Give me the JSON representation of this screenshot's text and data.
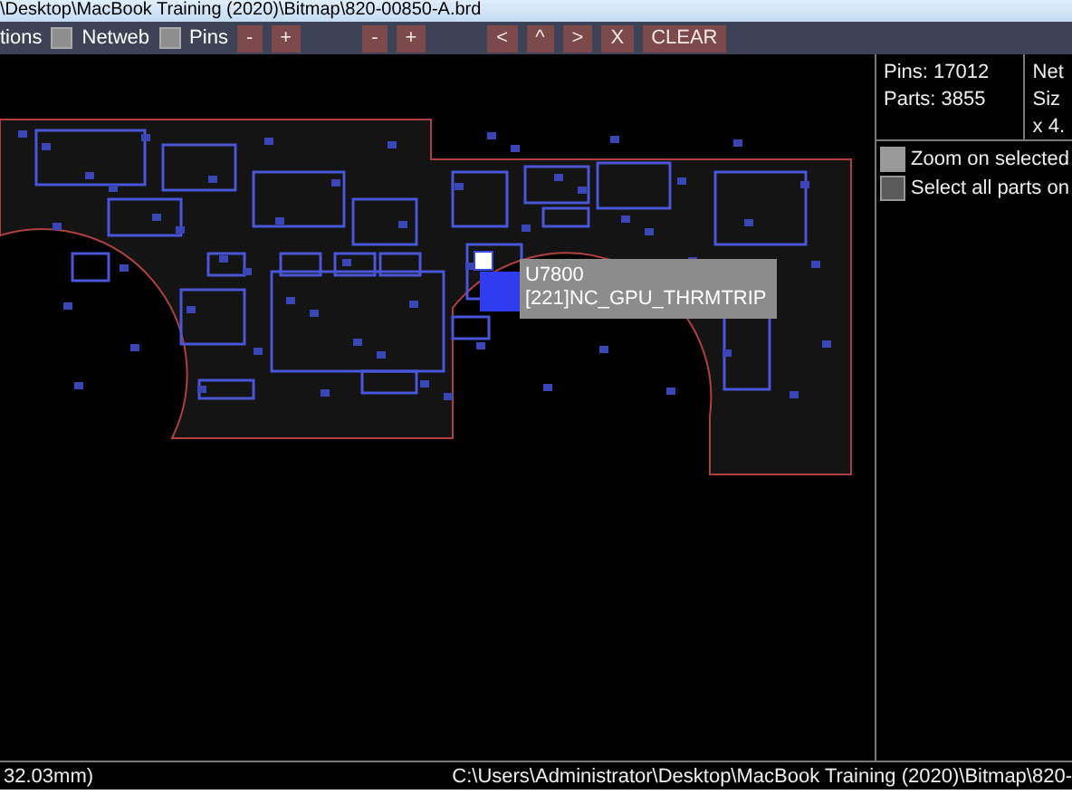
{
  "window": {
    "title": "\\Desktop\\MacBook Training (2020)\\Bitmap\\820-00850-A.brd"
  },
  "toolbar": {
    "items": [
      {
        "kind": "label",
        "label": "tions"
      },
      {
        "kind": "checkbox",
        "label": "Netweb",
        "checked": false
      },
      {
        "kind": "checkbox",
        "label": "Pins",
        "checked": false
      },
      {
        "kind": "button",
        "label": "-"
      },
      {
        "kind": "button",
        "label": "+"
      },
      {
        "kind": "gap"
      },
      {
        "kind": "button",
        "label": "-"
      },
      {
        "kind": "button",
        "label": "+"
      },
      {
        "kind": "gap"
      },
      {
        "kind": "button",
        "label": "<"
      },
      {
        "kind": "button",
        "label": "^"
      },
      {
        "kind": "button",
        "label": ">"
      },
      {
        "kind": "button",
        "label": "X"
      },
      {
        "kind": "button",
        "label": "CLEAR"
      }
    ]
  },
  "tooltip": {
    "part": "U7800",
    "net": "[221]NC_GPU_THRMTRIP"
  },
  "info": {
    "left": [
      "Pins: 17012",
      "Parts: 3855"
    ],
    "right": [
      "Net",
      "Siz",
      "x 4."
    ]
  },
  "options": [
    {
      "label": "Zoom on selected",
      "checked": true
    },
    {
      "label": "Select all parts on",
      "checked": false
    }
  ],
  "status_bar": {
    "left": "32.03mm)",
    "right": "C:\\Users\\Administrator\\Desktop\\MacBook Training (2020)\\Bitmap\\820-"
  }
}
